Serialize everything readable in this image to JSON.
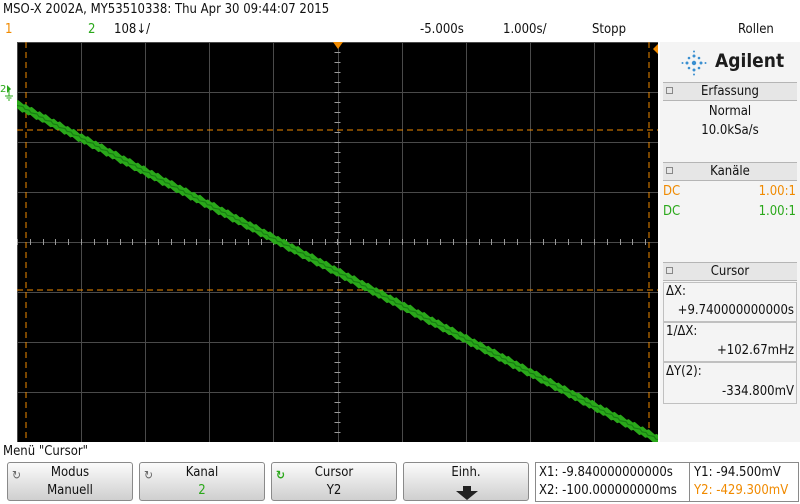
{
  "header": {
    "title": "MSO-X 2002A, MY53510338: Thu Apr 30 09:44:07 2015",
    "ch1_label": "1",
    "ch2_label": "2",
    "ch2_scale": "108↓/",
    "delay": "-5.000s",
    "timebase": "1.000s/",
    "run_state": "Stopp",
    "mode": "Rollen"
  },
  "colors": {
    "ch1": "#f08a00",
    "ch2": "#2aa81a",
    "background": "#000000",
    "grid": "#4a4a4a"
  },
  "panel": {
    "brand": "Agilent",
    "brand_icon": "agilent-spark-icon",
    "acquisition": {
      "heading": "Erfassung",
      "mode": "Normal",
      "rate": "10.0kSa/s"
    },
    "channels": {
      "heading": "Kanäle",
      "rows": [
        {
          "coupling": "DC",
          "probe": "1.00:1"
        },
        {
          "coupling": "DC",
          "probe": "1.00:1"
        }
      ]
    },
    "cursor": {
      "heading": "Cursor",
      "dx_label": "ΔX:",
      "dx_value": "+9.740000000000s",
      "inv_label": "1/ΔX:",
      "inv_value": "+102.67mHz",
      "dy_label": "ΔY(2):",
      "dy_value": "-334.800mV"
    }
  },
  "menu": {
    "title": "Menü \"Cursor\"",
    "softkeys": [
      {
        "label": "Modus",
        "value": "Manuell",
        "icon": "rotary-knob-icon"
      },
      {
        "label": "Kanal",
        "value": "2",
        "icon": "rotary-knob-icon"
      },
      {
        "label": "Cursor",
        "value": "Y2",
        "icon": "refresh-arrow-icon"
      },
      {
        "label": "Einh.",
        "value": "",
        "icon": "down-arrow-icon"
      }
    ]
  },
  "readout": {
    "x1": "X1: -9.840000000000s",
    "x2": "X2: -100.000000000ms",
    "y1": "Y1: -94.500mV",
    "y2": "Y2: -429.300mV"
  },
  "trace": {
    "description_values": "ch2 falling ramp",
    "start_level_div": 2.75,
    "end_level_div": -3.95
  }
}
